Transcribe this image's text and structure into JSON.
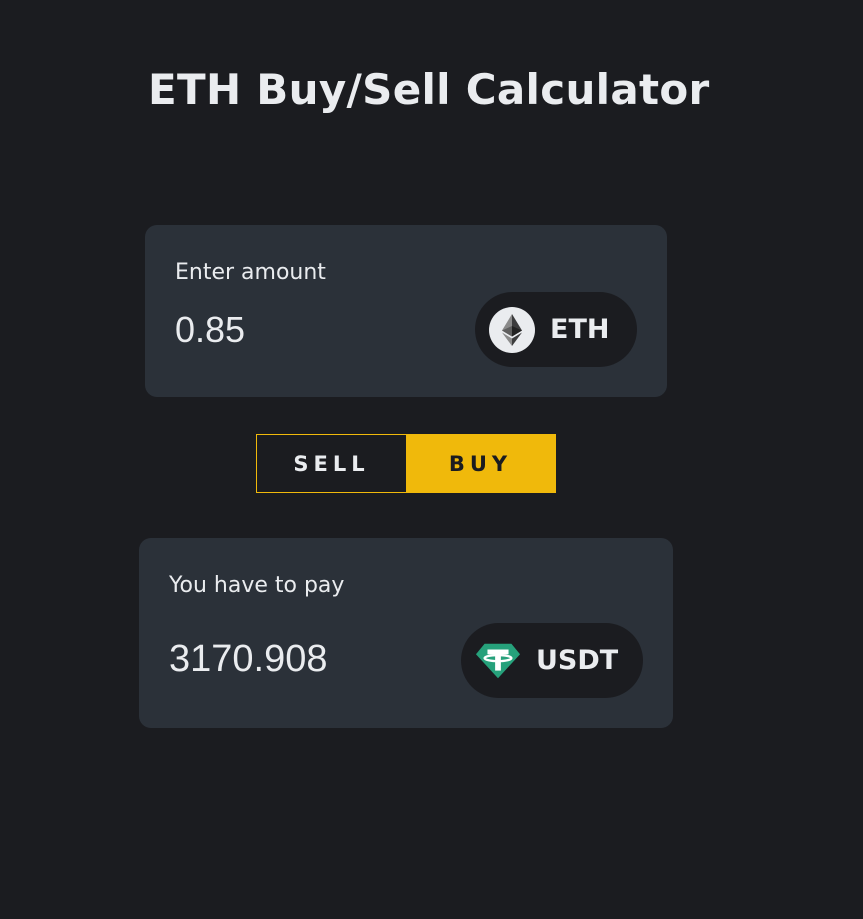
{
  "header": {
    "title": "ETH Buy/Sell Calculator"
  },
  "amount_card": {
    "label": "Enter amount",
    "value": "0.85",
    "token": {
      "symbol": "ETH",
      "icon": "ethereum-icon"
    }
  },
  "mode_toggle": {
    "sell_label": "SELL",
    "buy_label": "BUY",
    "selected": "BUY"
  },
  "pay_card": {
    "label": "You have to pay",
    "value": "3170.908",
    "token": {
      "symbol": "USDT",
      "icon": "tether-icon"
    }
  },
  "colors": {
    "background": "#1b1c20",
    "card": "#2b3139",
    "accent": "#f0b90b",
    "text": "#eaecef",
    "tether": "#26a17b"
  }
}
